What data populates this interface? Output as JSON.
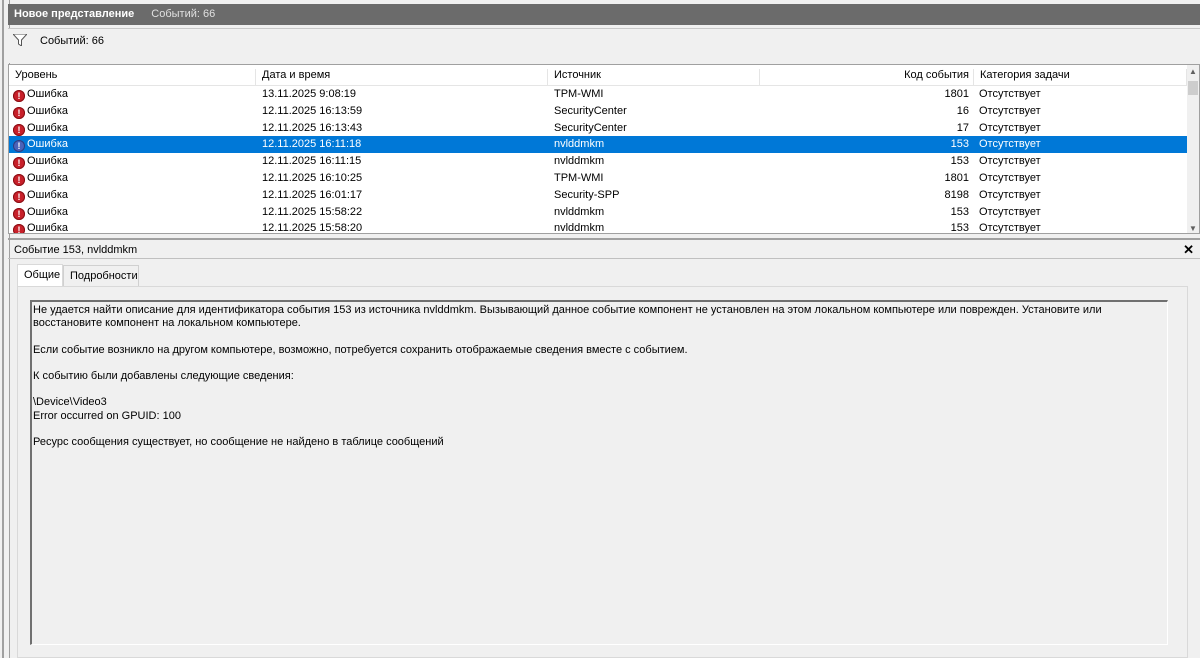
{
  "title": {
    "view": "Новое представление",
    "count": "Событий: 66"
  },
  "filter": {
    "icon": "filter-icon",
    "text": "Событий: 66"
  },
  "columns": [
    "Уровень",
    "Дата и время",
    "Источник",
    "Код события",
    "Категория задачи"
  ],
  "rows": [
    {
      "level": "Ошибка",
      "date": "13.11.2025 9:08:19",
      "source": "TPM-WMI",
      "code": "1801",
      "category": "Отсутствует"
    },
    {
      "level": "Ошибка",
      "date": "12.11.2025 16:13:59",
      "source": "SecurityCenter",
      "code": "16",
      "category": "Отсутствует"
    },
    {
      "level": "Ошибка",
      "date": "12.11.2025 16:13:43",
      "source": "SecurityCenter",
      "code": "17",
      "category": "Отсутствует"
    },
    {
      "level": "Ошибка",
      "date": "12.11.2025 16:11:18",
      "source": "nvlddmkm",
      "code": "153",
      "category": "Отсутствует",
      "selected": true
    },
    {
      "level": "Ошибка",
      "date": "12.11.2025 16:11:15",
      "source": "nvlddmkm",
      "code": "153",
      "category": "Отсутствует"
    },
    {
      "level": "Ошибка",
      "date": "12.11.2025 16:10:25",
      "source": "TPM-WMI",
      "code": "1801",
      "category": "Отсутствует"
    },
    {
      "level": "Ошибка",
      "date": "12.11.2025 16:01:17",
      "source": "Security-SPP",
      "code": "8198",
      "category": "Отсутствует"
    },
    {
      "level": "Ошибка",
      "date": "12.11.2025 15:58:22",
      "source": "nvlddmkm",
      "code": "153",
      "category": "Отсутствует"
    },
    {
      "level": "Ошибка",
      "date": "12.11.2025 15:58:20",
      "source": "nvlddmkm",
      "code": "153",
      "category": "Отсутствует"
    }
  ],
  "detail": {
    "header": "Событие 153, nvlddmkm",
    "close": "✕",
    "tabs": [
      "Общие",
      "Подробности"
    ],
    "description": [
      "Не удается найти описание для идентификатора события 153 из источника nvlddmkm. Вызывающий данное событие компонент не установлен на этом локальном компьютере или поврежден. Установите или восстановите компонент на локальном компьютере.",
      "",
      "Если событие возникло на другом компьютере, возможно, потребуется сохранить отображаемые сведения вместе с событием.",
      "",
      "К событию были добавлены следующие сведения:",
      "",
      "\\Device\\Video3",
      "Error occurred on GPUID: 100",
      "",
      "Ресурс сообщения существует, но сообщение не найдено в таблице сообщений"
    ]
  },
  "colors": {
    "selection": "#0078d7",
    "title_bar": "#6b6b6b",
    "error": "#c8202a"
  }
}
